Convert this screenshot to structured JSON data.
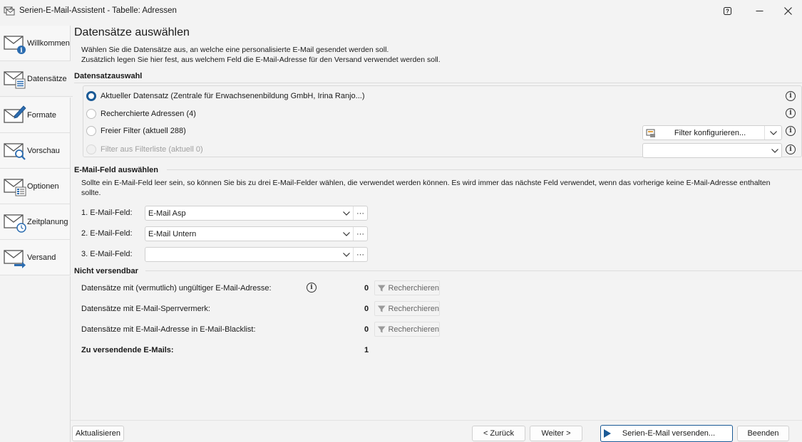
{
  "window": {
    "title": "Serien-E-Mail-Assistent - Tabelle: Adressen",
    "help_label": "?",
    "minimize_label": "—",
    "close_label": "✕"
  },
  "sidebar": {
    "items": [
      {
        "label": "Willkommen",
        "icon": "mail-info-icon"
      },
      {
        "label": "Datensätze",
        "icon": "mail-records-icon"
      },
      {
        "label": "Formate",
        "icon": "mail-format-icon"
      },
      {
        "label": "Vorschau",
        "icon": "mail-preview-icon"
      },
      {
        "label": "Optionen",
        "icon": "mail-options-icon"
      },
      {
        "label": "Zeitplanung",
        "icon": "mail-schedule-icon"
      },
      {
        "label": "Versand",
        "icon": "mail-send-icon"
      }
    ],
    "active_index": 1
  },
  "main": {
    "heading": "Datensätze auswählen",
    "description_line1": "Wählen Sie die Datensätze aus, an welche eine personalisierte E-Mail gesendet werden soll.",
    "description_line2": "Zusätzlich legen Sie hier fest, aus welchem Feld die E-Mail-Adresse für den Versand verwendet werden soll.",
    "datensatzauswahl": {
      "title": "Datensatzauswahl",
      "options": [
        {
          "label": "Aktueller Datensatz (Zentrale für Erwachsenenbildung GmbH, Irina Ranjo...)",
          "checked": true,
          "disabled": false
        },
        {
          "label": "Recherchierte Adressen (4)",
          "checked": false,
          "disabled": false
        },
        {
          "label": "Freier Filter (aktuell 288)",
          "checked": false,
          "disabled": false
        },
        {
          "label": "Filter aus Filterliste (aktuell 0)",
          "checked": false,
          "disabled": true
        }
      ],
      "filter_button_label": "Filter konfigurieren...",
      "filter_list_value": ""
    },
    "email_field": {
      "title": "E-Mail-Feld auswählen",
      "description_line1": "Sollte ein E-Mail-Feld leer sein, so können Sie bis zu drei E-Mail-Felder wählen, die verwendet werden können. Es wird immer das nächste Feld verwendet, wenn das vorherige keine E-Mail-Adresse enthalten",
      "description_line2": "sollte.",
      "fields": [
        {
          "label": "1. E-Mail-Feld:",
          "value": "E-Mail Asp"
        },
        {
          "label": "2. E-Mail-Feld:",
          "value": "E-Mail Untern"
        },
        {
          "label": "3. E-Mail-Feld:",
          "value": ""
        }
      ],
      "more_label": "···"
    },
    "not_sendable": {
      "title": "Nicht versendbar",
      "rows": [
        {
          "label": "Datensätze mit (vermutlich) ungültiger E-Mail-Adresse:",
          "count": "0",
          "button": "Recherchieren"
        },
        {
          "label": "Datensätze mit E-Mail-Sperrvermerk:",
          "count": "0",
          "button": "Recherchieren"
        },
        {
          "label": "Datensätze mit E-Mail-Adresse in E-Mail-Blacklist:",
          "count": "0",
          "button": "Recherchieren"
        }
      ],
      "total_label": "Zu versendende E-Mails:",
      "total_count": "1"
    }
  },
  "footer": {
    "refresh": "Aktualisieren",
    "back": "< Zurück",
    "next": "Weiter >",
    "send": "Serien-E-Mail versenden...",
    "close": "Beenden"
  },
  "colors": {
    "accent": "#1a5a96",
    "background": "#f3f3f3"
  }
}
